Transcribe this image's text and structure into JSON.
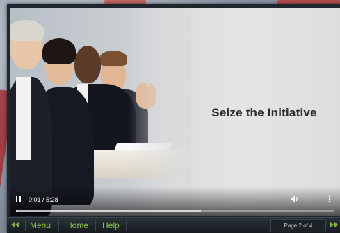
{
  "slide": {
    "title": "Seize the Initiative"
  },
  "player": {
    "time": "0:01 / 5:28",
    "progress_fraction": 0.004,
    "buffer_fraction": 0.58,
    "icons": [
      "pause-icon",
      "volume-icon",
      "fullscreen-icon",
      "more-options-icon"
    ]
  },
  "nav": {
    "menu_label": "Menu",
    "home_label": "Home",
    "help_label": "Help",
    "page_indicator": "Page 2 of 4",
    "accent_color": "#8bc34a"
  }
}
